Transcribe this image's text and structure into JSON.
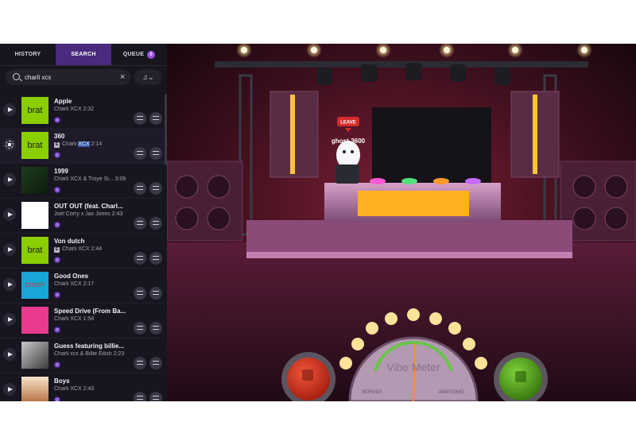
{
  "tabs": [
    {
      "label": "HISTORY"
    },
    {
      "label": "SEARCH"
    },
    {
      "label": "QUEUE",
      "badge": "0"
    }
  ],
  "search": {
    "value": "charli xcx",
    "clear": "×",
    "filter": "♫⌄"
  },
  "songs": [
    {
      "title": "Apple",
      "meta": "Charli XCX  2:32",
      "art": "brat",
      "explicit": false
    },
    {
      "title": "360",
      "artist": "Charli",
      "hl": "XCX",
      "time": "2:14",
      "art": "brat",
      "explicit": true
    },
    {
      "title": "1999",
      "meta": "Charli XCX & Troye Si...  3:09",
      "art": "",
      "explicit": false
    },
    {
      "title": "OUT OUT (feat. Charl...",
      "meta": "Joel Corry x Jax Jones  2:43",
      "art": "",
      "explicit": false
    },
    {
      "title": "Von dutch",
      "meta": "Charli XCX  2:44",
      "art": "brat",
      "explicit": true
    },
    {
      "title": "Good Ones",
      "meta": "Charli XCX  2:17",
      "art": "crash",
      "explicit": false
    },
    {
      "title": "Speed Drive (From Ba...",
      "meta": "Charli XCX  1:58",
      "art": "",
      "explicit": false
    },
    {
      "title": "Guess featuring billie...",
      "meta": "Charli xcx & Billie Eilish  2:23",
      "art": "",
      "explicit": false
    },
    {
      "title": "Boys",
      "meta": "Charli XCX  2:43",
      "art": "",
      "explicit": false
    }
  ],
  "stage": {
    "leave_label": "LEAVE",
    "username": "ghost-3600",
    "meter_title": "Vibe Meter",
    "meter_left": "BORING!",
    "meter_right": "AWESOME!",
    "colors": {
      "stage_red": "#7a1a2e",
      "floor": "#4a1630",
      "thumb_down": "#c8331f",
      "thumb_up": "#4f9a1e",
      "bulb": "#ffd874"
    }
  }
}
